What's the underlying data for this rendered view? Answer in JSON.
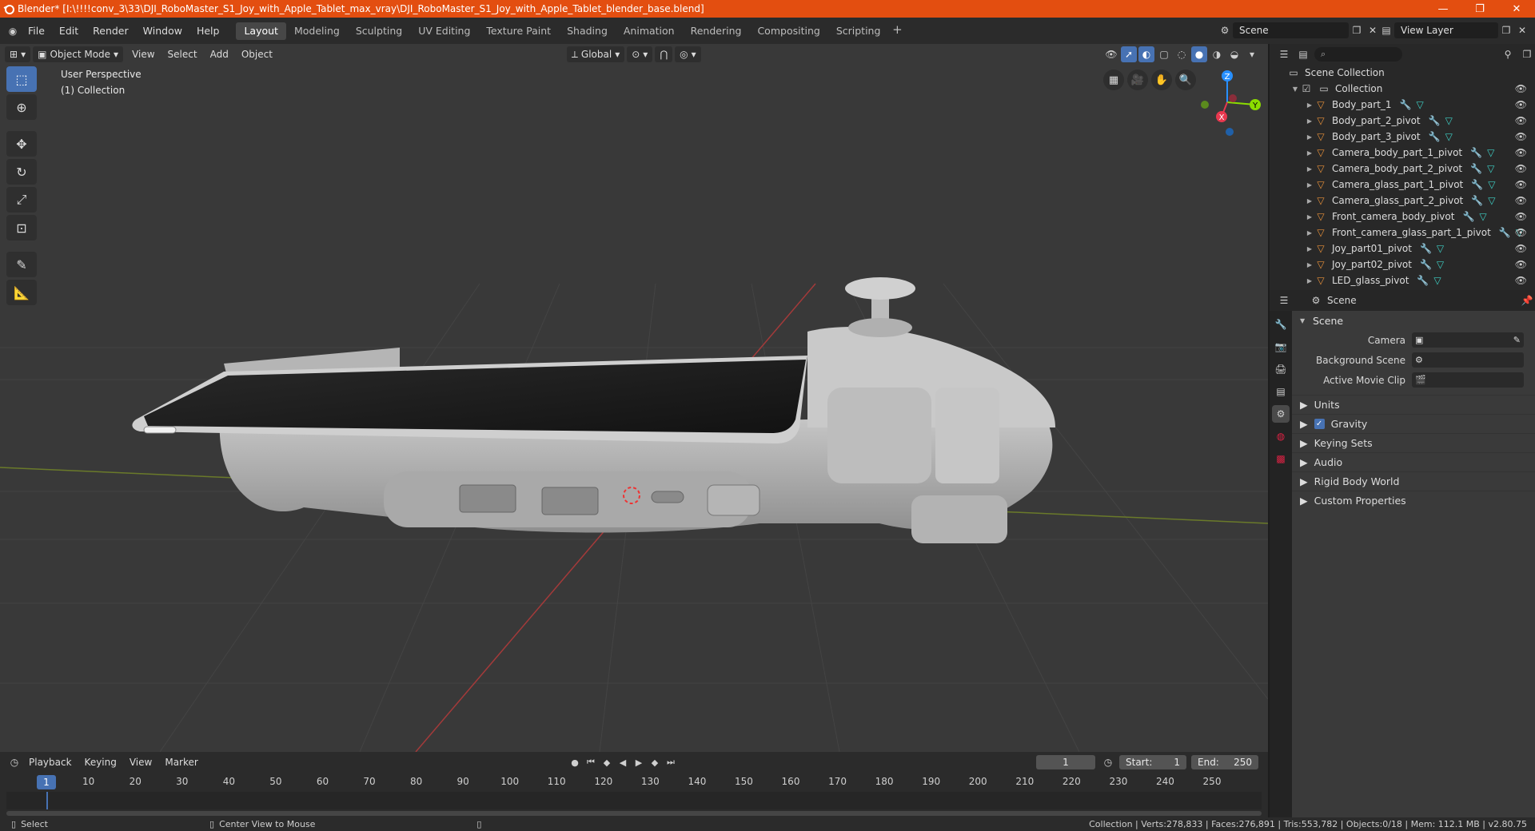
{
  "window": {
    "title": "Blender* [I:\\!!!!conv_3\\33\\DJI_RoboMaster_S1_Joy_with_Apple_Tablet_max_vray\\DJI_RoboMaster_S1_Joy_with_Apple_Tablet_blender_base.blend]",
    "controls": [
      "—",
      "❐",
      "✕"
    ]
  },
  "menu": [
    "File",
    "Edit",
    "Render",
    "Window",
    "Help"
  ],
  "workspaces": [
    "Layout",
    "Modeling",
    "Sculpting",
    "UV Editing",
    "Texture Paint",
    "Shading",
    "Animation",
    "Rendering",
    "Compositing",
    "Scripting"
  ],
  "active_workspace": "Layout",
  "scene_selector": "Scene",
  "view_layer_selector": "View Layer",
  "viewport": {
    "mode": "Object Mode",
    "menus": [
      "View",
      "Select",
      "Add",
      "Object"
    ],
    "transform": "Global",
    "perspective_label": "User Perspective",
    "collection_label": "(1) Collection",
    "gizmo": {
      "x": "X",
      "y": "Y",
      "z": "Z"
    }
  },
  "timeline": {
    "menus": [
      "Playback",
      "Keying",
      "View",
      "Marker"
    ],
    "current_frame": "1",
    "start_label": "Start:",
    "start": "1",
    "end_label": "End:",
    "end": "250",
    "ticks": [
      "1",
      "10",
      "20",
      "30",
      "40",
      "50",
      "60",
      "70",
      "80",
      "90",
      "100",
      "110",
      "120",
      "130",
      "140",
      "150",
      "160",
      "170",
      "180",
      "190",
      "200",
      "210",
      "220",
      "230",
      "240",
      "250"
    ]
  },
  "statusbar": {
    "select": "Select",
    "center_view": "Center View to Mouse",
    "stats": "Collection | Verts:278,833 | Faces:276,891 | Tris:553,782 | Objects:0/18 | Mem: 112.1 MB | v2.80.75"
  },
  "outliner": {
    "root": "Scene Collection",
    "collection": "Collection",
    "items": [
      "Body_part_1",
      "Body_part_2_pivot",
      "Body_part_3_pivot",
      "Camera_body_part_1_pivot",
      "Camera_body_part_2_pivot",
      "Camera_glass_part_1_pivot",
      "Camera_glass_part_2_pivot",
      "Front_camera_body_pivot",
      "Front_camera_glass_part_1_pivot",
      "Joy_part01_pivot",
      "Joy_part02_pivot",
      "LED_glass_pivot"
    ]
  },
  "properties": {
    "header": "Scene",
    "panel": "Scene",
    "fields": [
      {
        "label": "Camera"
      },
      {
        "label": "Background Scene"
      },
      {
        "label": "Active Movie Clip"
      }
    ],
    "subpanels": [
      "Units",
      "Gravity",
      "Keying Sets",
      "Audio",
      "Rigid Body World",
      "Custom Properties"
    ]
  },
  "colors": {
    "title_bar": "#e34e10",
    "accent": "#4772b3",
    "object_icon": "#e8913a",
    "modifier_icon": "#6ea8ff",
    "mesh_icon": "#3ed0c6",
    "axis_x": "#e8384f",
    "axis_y": "#8bdc00",
    "axis_z": "#2890ff"
  }
}
